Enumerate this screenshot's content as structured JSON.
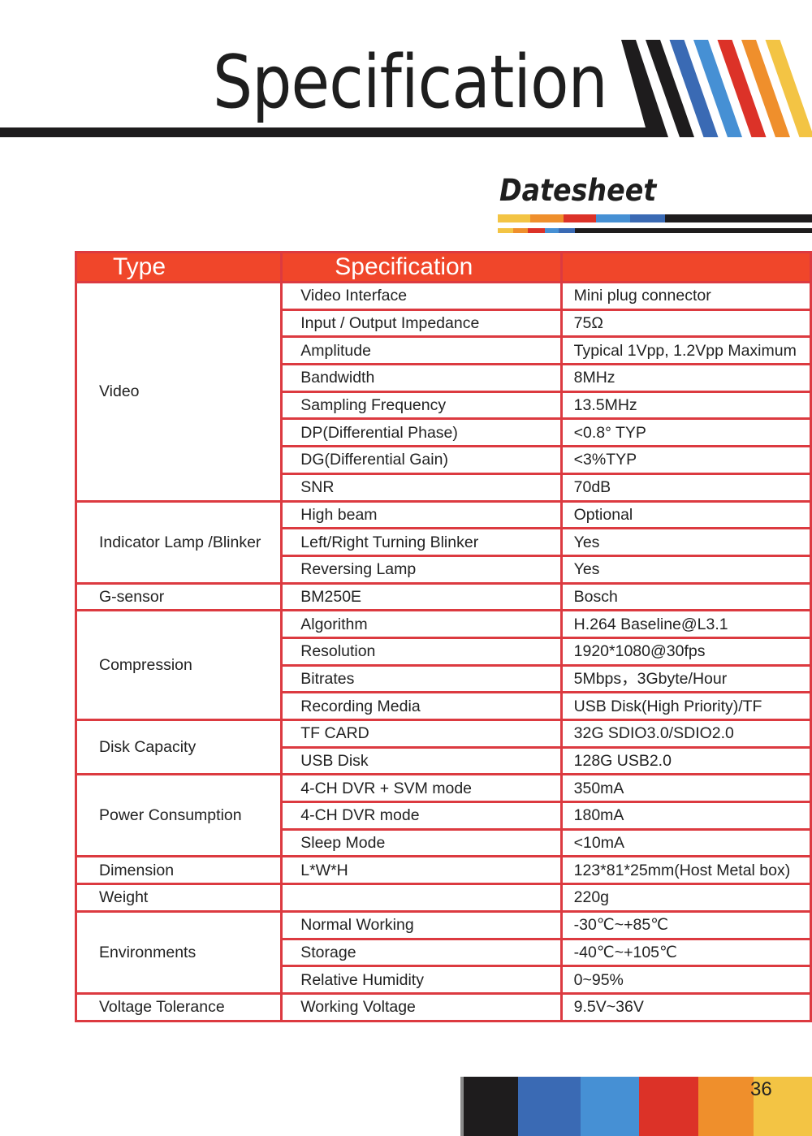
{
  "header": {
    "title": "Specification",
    "subtitle": "Datesheet"
  },
  "colors": {
    "black": "#1e1c1d",
    "blue_dark": "#3a6ab4",
    "blue_light": "#4690d4",
    "red": "#dc3228",
    "orange": "#ef8f2c",
    "yellow": "#f3c444",
    "table_header": "#f0462a",
    "table_border": "#dc3a40"
  },
  "table": {
    "headers": [
      "Type",
      "Specification",
      ""
    ],
    "groups": [
      {
        "type": "Video",
        "rows": [
          [
            "Video Interface",
            "Mini plug connector"
          ],
          [
            "Input / Output Impedance",
            "75Ω"
          ],
          [
            "Amplitude",
            "Typical 1Vpp, 1.2Vpp Maximum"
          ],
          [
            "Bandwidth",
            "8MHz"
          ],
          [
            "Sampling Frequency",
            "13.5MHz"
          ],
          [
            "DP(Differential Phase)",
            "<0.8°  TYP"
          ],
          [
            "DG(Differential Gain)",
            "<3%TYP"
          ],
          [
            "SNR",
            "70dB"
          ]
        ]
      },
      {
        "type": "Indicator Lamp /Blinker",
        "rows": [
          [
            "High beam",
            "Optional"
          ],
          [
            "Left/Right Turning Blinker",
            "Yes"
          ],
          [
            "Reversing Lamp",
            "Yes"
          ]
        ]
      },
      {
        "type": "G-sensor",
        "rows": [
          [
            "BM250E",
            "Bosch"
          ]
        ]
      },
      {
        "type": "Compression",
        "rows": [
          [
            "Algorithm",
            "H.264 Baseline@L3.1"
          ],
          [
            "Resolution",
            "1920*1080@30fps"
          ],
          [
            "Bitrates",
            "5Mbps，3Gbyte/Hour"
          ],
          [
            "Recording Media",
            "USB Disk(High Priority)/TF"
          ]
        ]
      },
      {
        "type": "Disk Capacity",
        "rows": [
          [
            "TF CARD",
            "32G SDIO3.0/SDIO2.0"
          ],
          [
            "USB Disk",
            "128G USB2.0"
          ]
        ]
      },
      {
        "type": "Power Consumption",
        "rows": [
          [
            "4-CH DVR + SVM mode",
            "350mA"
          ],
          [
            "4-CH DVR mode",
            "180mA"
          ],
          [
            "Sleep Mode",
            "<10mA"
          ]
        ]
      },
      {
        "type": "Dimension",
        "rows": [
          [
            "L*W*H",
            "123*81*25mm(Host Metal box)"
          ]
        ]
      },
      {
        "type": "Weight",
        "rows": [
          [
            "",
            "220g"
          ]
        ]
      },
      {
        "type": "Environments",
        "rows": [
          [
            "Normal Working",
            "-30℃~+85℃"
          ],
          [
            "Storage",
            "-40℃~+105℃"
          ],
          [
            "Relative Humidity",
            "0~95%"
          ]
        ]
      },
      {
        "type": "Voltage Tolerance",
        "rows": [
          [
            "Working Voltage",
            "9.5V~36V"
          ]
        ]
      }
    ]
  },
  "footer": {
    "page_number": "36"
  }
}
